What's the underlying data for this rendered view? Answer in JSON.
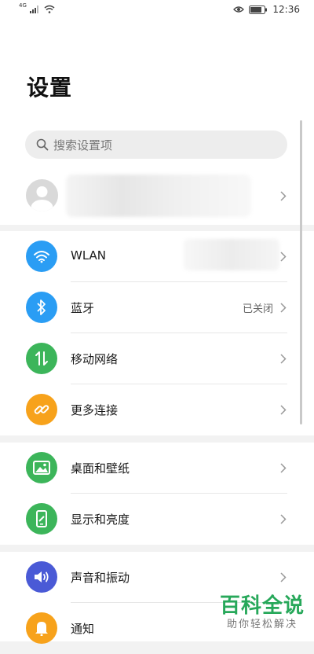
{
  "status_bar": {
    "network": "4G",
    "time": "12:36",
    "icons": [
      "signal-icon",
      "wifi-icon",
      "eye-icon",
      "battery-icon"
    ]
  },
  "page": {
    "title": "设置"
  },
  "search": {
    "placeholder": "搜索设置项"
  },
  "groups": [
    {
      "items": [
        {
          "name": "wlan",
          "label": "WLAN",
          "icon": "wifi-icon",
          "color": "#2a9df4",
          "value": ""
        },
        {
          "name": "bluetooth",
          "label": "蓝牙",
          "icon": "bluetooth-icon",
          "color": "#2a9df4",
          "value": "已关闭"
        },
        {
          "name": "mobile-network",
          "label": "移动网络",
          "icon": "mobile-data-icon",
          "color": "#3cb55a",
          "value": ""
        },
        {
          "name": "more-connections",
          "label": "更多连接",
          "icon": "link-icon",
          "color": "#f7a21b",
          "value": ""
        }
      ]
    },
    {
      "items": [
        {
          "name": "wallpaper",
          "label": "桌面和壁纸",
          "icon": "image-icon",
          "color": "#3cb55a",
          "value": ""
        },
        {
          "name": "display",
          "label": "显示和亮度",
          "icon": "phone-brightness-icon",
          "color": "#3cb55a",
          "value": ""
        }
      ]
    },
    {
      "items": [
        {
          "name": "sound",
          "label": "声音和振动",
          "icon": "speaker-icon",
          "color": "#4a5ad6",
          "value": ""
        },
        {
          "name": "notification",
          "label": "通知",
          "icon": "bell-icon",
          "color": "#f7a21b",
          "value": ""
        }
      ]
    }
  ],
  "watermark": {
    "title": "百科全说",
    "subtitle": "助你轻松解决"
  }
}
